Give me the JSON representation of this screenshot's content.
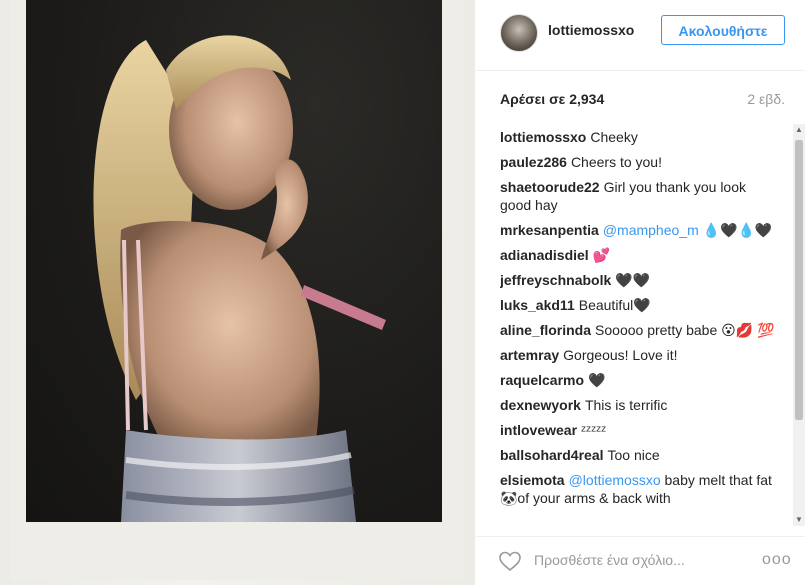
{
  "post": {
    "username": "lottiemossxo",
    "follow_label": "Ακολουθήστε",
    "likes": "Αρέσει σε 2,934",
    "age": "2 εβδ."
  },
  "comments": [
    {
      "user": "lottiemossxo",
      "text": "Cheeky"
    },
    {
      "user": "paulez286",
      "text": "Cheers to you!"
    },
    {
      "user": "shaetoorude22",
      "text": "Girl you thank you look good hay"
    },
    {
      "user": "mrkesanpentia",
      "mention": "@mampheo_m",
      "text": " 💧🖤💧🖤"
    },
    {
      "user": "adianadisdiel",
      "text": "💕"
    },
    {
      "user": "jeffreyschnabolk",
      "text": "🖤🖤"
    },
    {
      "user": "luks_akd11",
      "text": "Beautiful🖤"
    },
    {
      "user": "aline_florinda",
      "text": "Sooooo pretty babe 😮💋 💯"
    },
    {
      "user": "artemray",
      "text": "Gorgeous! Love it!"
    },
    {
      "user": "raquelcarmo",
      "text": "🖤"
    },
    {
      "user": "dexnewyork",
      "text": "This is terrific"
    },
    {
      "user": "intlovewear",
      "text": "ᶻᶻᶻᶻᶻ"
    },
    {
      "user": "ballsohard4real",
      "text": "Too nice"
    },
    {
      "user": "elsiemota",
      "mention": "@lottiemossxo",
      "text": " baby melt that fat 🐼of your arms & back with"
    }
  ],
  "footer": {
    "add_comment_placeholder": "Προσθέστε ένα σχόλιο...",
    "more_label": "ooo"
  },
  "colors": {
    "accent": "#3897f0",
    "text": "#262626",
    "muted": "#999999"
  },
  "icons": {
    "like": "heart-icon",
    "more": "more-options-icon"
  }
}
